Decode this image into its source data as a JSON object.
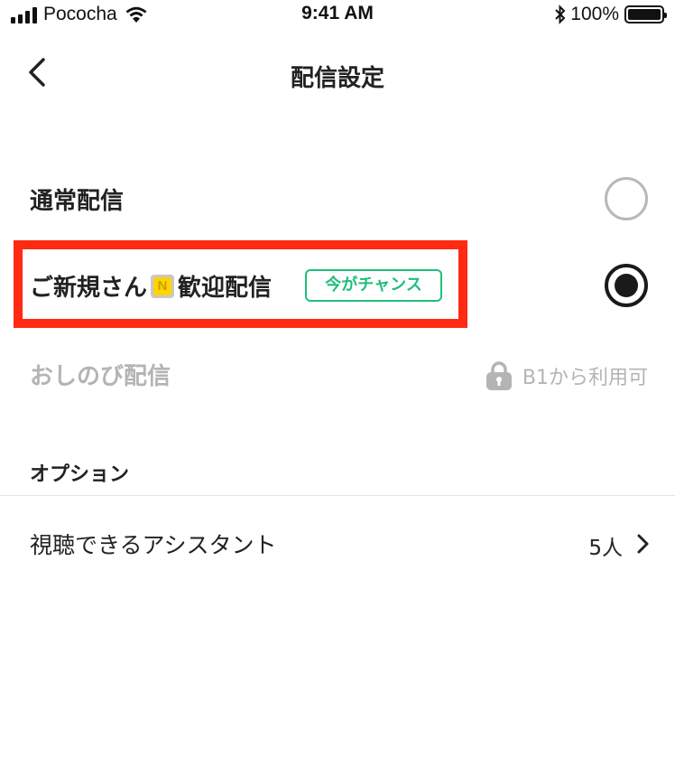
{
  "status_bar": {
    "carrier": "Pococha",
    "time": "9:41 AM",
    "battery": "100%",
    "icons": [
      "signal-icon",
      "wifi-icon",
      "bluetooth-icon",
      "battery-icon"
    ]
  },
  "nav": {
    "title": "配信設定",
    "back_icon": "chevron-left-icon"
  },
  "options": {
    "normal": {
      "label": "通常配信",
      "selected": false
    },
    "newcomer": {
      "label_prefix": "ご新規さん",
      "badge": "N",
      "label_suffix": "歓迎配信",
      "tag": "今がチャンス",
      "selected": true
    },
    "secret": {
      "label": "おしのび配信",
      "lock_text": "B1から利用可",
      "lock_icon": "lock-icon"
    }
  },
  "section": {
    "header": "オプション",
    "assistant": {
      "label": "視聴できるアシスタント",
      "value": "5人"
    }
  },
  "colors": {
    "highlight": "#ff2a12",
    "tag_green": "#1fbf7a",
    "disabled": "#b4b4b4"
  }
}
